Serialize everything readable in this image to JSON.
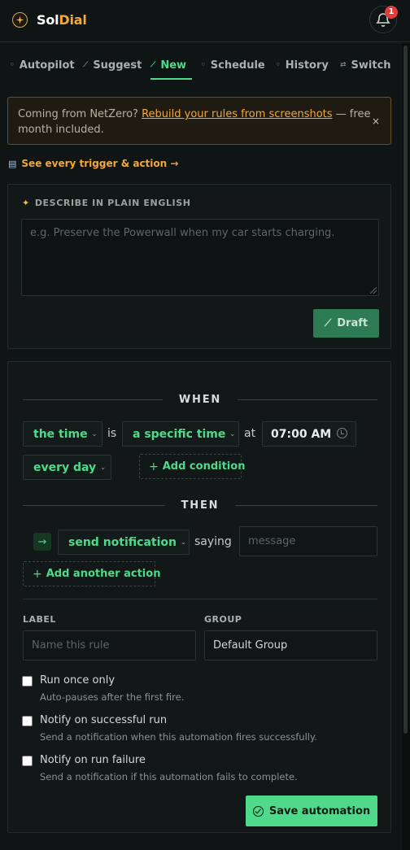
{
  "app": {
    "name_part1": "Sol",
    "name_part2": "Dial",
    "notifications_count": "1",
    "colors": {
      "accent_green": "#4fd98a",
      "accent_orange": "#f4a83a",
      "badge_red": "#e23b3b"
    }
  },
  "tabs": [
    {
      "label": "Autopilot",
      "icon": "autopilot-icon",
      "active": false
    },
    {
      "label": "Suggest",
      "icon": "suggest-icon",
      "active": false
    },
    {
      "label": "New",
      "icon": "new-wand-icon",
      "active": true
    },
    {
      "label": "Schedule",
      "icon": "schedule-icon",
      "active": false
    },
    {
      "label": "History",
      "icon": "history-icon",
      "active": false
    },
    {
      "label": "Switch",
      "icon": "switch-icon",
      "active": false
    }
  ],
  "banner": {
    "prefix": "Coming from NetZero?",
    "link_text": "Rebuild your rules from screenshots",
    "suffix": " — free month included.",
    "close": "×"
  },
  "help_link": {
    "text": "See every trigger & action →"
  },
  "describe": {
    "title": "DESCRIBE IN PLAIN ENGLISH",
    "placeholder": "e.g. Preserve the Powerwall when my car starts charging.",
    "draft_label": "Draft"
  },
  "when": {
    "heading": "WHEN",
    "trigger_select": "the time",
    "is_text": "is",
    "operator_select": "a specific time",
    "at_text": "at",
    "time_value": "07:00 AM",
    "frequency_select": "every day",
    "add_condition": "Add condition"
  },
  "then": {
    "heading": "THEN",
    "action_select": "send notification",
    "saying_text": "saying",
    "message_placeholder": "message",
    "add_action": "Add another action"
  },
  "meta": {
    "label_heading": "LABEL",
    "label_placeholder": "Name this rule",
    "group_heading": "GROUP",
    "group_value": "Default Group"
  },
  "options": [
    {
      "title": "Run once only",
      "desc": "Auto-pauses after the first fire.",
      "checked": false
    },
    {
      "title": "Notify on successful run",
      "desc": "Send a notification when this automation fires successfully.",
      "checked": false
    },
    {
      "title": "Notify on run failure",
      "desc": "Send a notification if this automation fails to complete.",
      "checked": false
    }
  ],
  "save_label": "Save automation"
}
